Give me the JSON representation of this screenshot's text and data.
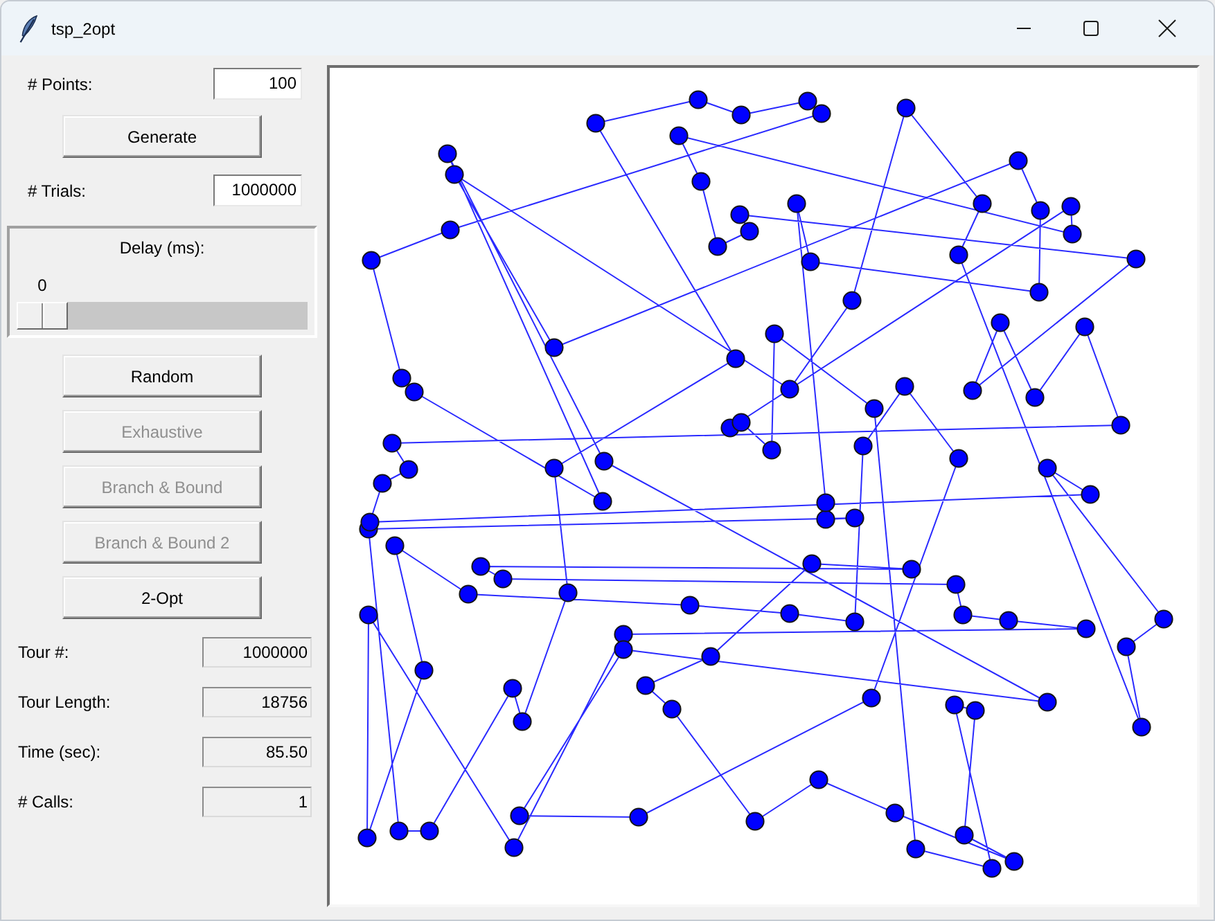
{
  "window": {
    "title": "tsp_2opt"
  },
  "controls": {
    "points": {
      "label": "# Points:",
      "value": "100"
    },
    "generate_button": {
      "label": "Generate"
    },
    "trials": {
      "label": "# Trials:",
      "value": "1000000"
    },
    "delay": {
      "label": "Delay (ms):",
      "reading": "0",
      "level": 0
    },
    "algorithm_buttons": [
      {
        "label": "Random",
        "disabled": false
      },
      {
        "label": "Exhaustive",
        "disabled": true
      },
      {
        "label": "Branch & Bound",
        "disabled": true
      },
      {
        "label": "Branch & Bound 2",
        "disabled": true
      },
      {
        "label": "2-Opt",
        "disabled": false
      }
    ]
  },
  "stats": [
    {
      "label": "Tour #:",
      "value": "1000000"
    },
    {
      "label": "Tour Length:",
      "value": "18756"
    },
    {
      "label": "Time (sec):",
      "value": "85.50"
    },
    {
      "label": "# Calls:",
      "value": "1"
    }
  ]
}
